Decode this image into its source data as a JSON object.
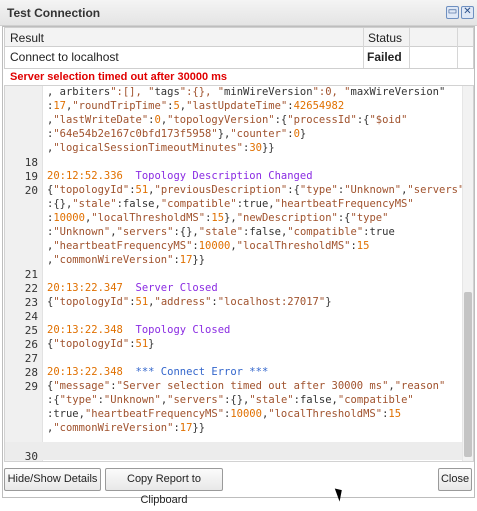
{
  "window": {
    "title": "Test Connection"
  },
  "results_table": {
    "headers": [
      "Result",
      "Status"
    ],
    "rows": [
      {
        "result": "Connect to localhost",
        "status": "Failed"
      }
    ]
  },
  "error_message": "Server selection timed out after 30000 ms",
  "log_lines": [
    {
      "n": "",
      "t": ", arbiters\":[], \"tags\":{}, \"minWireVersion\":0, \"maxWireVersion\""
    },
    {
      "n": "",
      "t": ":17,\"roundTripTime\":5,\"lastUpdateTime\":42654982"
    },
    {
      "n": "",
      "t": ",\"lastWriteDate\":0,\"topologyVersion\":{\"processId\":{\"$oid\""
    },
    {
      "n": "",
      "t": ":\"64e54b2e167c0bfd173f5958\"},\"counter\":0}"
    },
    {
      "n": "",
      "t": ",\"logicalSessionTimeoutMinutes\":30}}"
    },
    {
      "n": "18",
      "t": ""
    },
    {
      "n": "19",
      "t": "20:12:52.336  Topology Description Changed"
    },
    {
      "n": "20",
      "t": "{\"topologyId\":51,\"previousDescription\":{\"type\":\"Unknown\",\"servers\""
    },
    {
      "n": "",
      "t": ":{},\"stale\":false,\"compatible\":true,\"heartbeatFrequencyMS\""
    },
    {
      "n": "",
      "t": ":10000,\"localThresholdMS\":15},\"newDescription\":{\"type\""
    },
    {
      "n": "",
      "t": ":\"Unknown\",\"servers\":{},\"stale\":false,\"compatible\":true"
    },
    {
      "n": "",
      "t": ",\"heartbeatFrequencyMS\":10000,\"localThresholdMS\":15"
    },
    {
      "n": "",
      "t": ",\"commonWireVersion\":17}}"
    },
    {
      "n": "21",
      "t": ""
    },
    {
      "n": "22",
      "t": "20:13:22.347  Server Closed"
    },
    {
      "n": "23",
      "t": "{\"topologyId\":51,\"address\":\"localhost:27017\"}"
    },
    {
      "n": "24",
      "t": ""
    },
    {
      "n": "25",
      "t": "20:13:22.348  Topology Closed"
    },
    {
      "n": "26",
      "t": "{\"topologyId\":51}"
    },
    {
      "n": "27",
      "t": ""
    },
    {
      "n": "28",
      "t": "20:13:22.348  *** Connect Error ***"
    },
    {
      "n": "29",
      "t": "{\"message\":\"Server selection timed out after 30000 ms\",\"reason\""
    },
    {
      "n": "",
      "t": ":{\"type\":\"Unknown\",\"servers\":{},\"stale\":false,\"compatible\""
    },
    {
      "n": "",
      "t": ":true,\"heartbeatFrequencyMS\":10000,\"localThresholdMS\":15"
    },
    {
      "n": "",
      "t": ",\"commonWireVersion\":17}}"
    },
    {
      "n": "",
      "t": ""
    },
    {
      "n": "30",
      "t": ""
    }
  ],
  "buttons": {
    "hide_show": "Hide/Show Details",
    "copy_report": "Copy Report to Clipboard",
    "close": "Close"
  },
  "icons": {
    "restore": "restore-icon",
    "close": "close-icon"
  }
}
